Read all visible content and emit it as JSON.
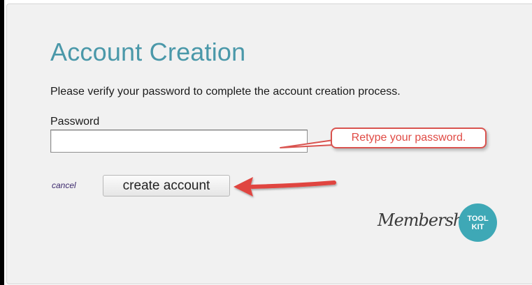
{
  "page": {
    "title": "Account Creation",
    "instruction": "Please verify your password to complete the account creation process."
  },
  "form": {
    "password_label": "Password",
    "password_value": "",
    "cancel_label": "cancel",
    "submit_label": "create account"
  },
  "annotation": {
    "callout_text": "Retype your password.",
    "callout_color": "#d9534f",
    "arrow_color": "#e0453f"
  },
  "logo": {
    "script_text": "Membership",
    "badge_line1": "TOOL",
    "badge_line2": "KIT",
    "badge_color": "#3ea8b6"
  },
  "colors": {
    "title": "#4a98a9",
    "panel_bg": "#f1f1f1",
    "link": "#3d2a6e"
  }
}
